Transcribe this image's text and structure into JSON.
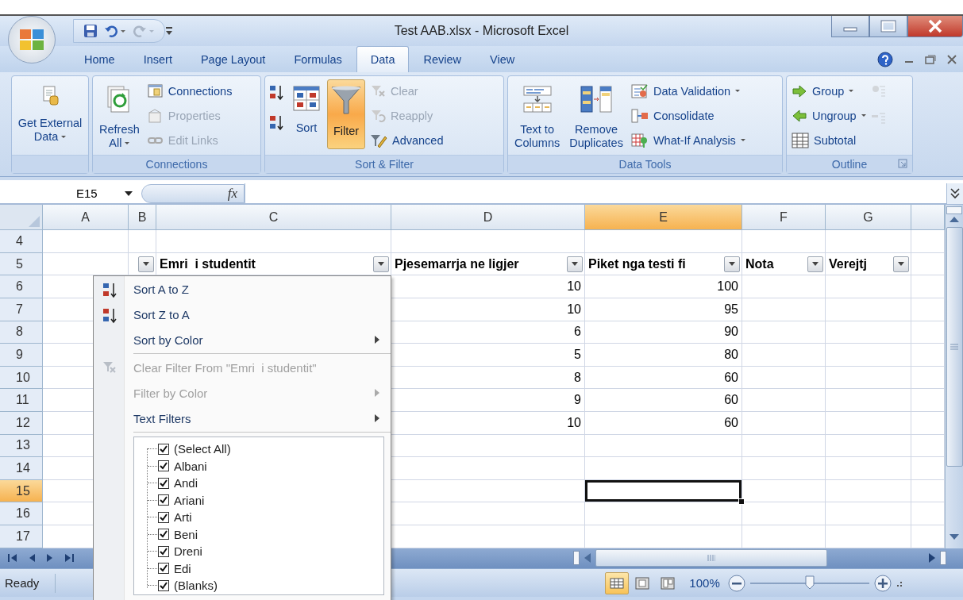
{
  "title_bar": {
    "title": "Test AAB.xlsx - Microsoft Excel"
  },
  "tabs": [
    {
      "label": "Home",
      "selected": false
    },
    {
      "label": "Insert",
      "selected": false
    },
    {
      "label": "Page Layout",
      "selected": false
    },
    {
      "label": "Formulas",
      "selected": false
    },
    {
      "label": "Data",
      "selected": true
    },
    {
      "label": "Review",
      "selected": false
    },
    {
      "label": "View",
      "selected": false
    }
  ],
  "ribbon": {
    "groups": [
      {
        "items": [
          {
            "kind": "large",
            "lines": [
              "Get External",
              "Data"
            ],
            "dropdown": true,
            "pressed": false
          }
        ]
      },
      {
        "label": "Connections",
        "items": [
          {
            "kind": "large",
            "lines": [
              "Refresh",
              "All"
            ],
            "dropdown": true,
            "pressed": false
          },
          {
            "kind": "stack",
            "buttons": [
              {
                "label": "Connections",
                "disabled": false,
                "dropdown": false
              },
              {
                "label": "Properties",
                "disabled": true,
                "dropdown": false
              },
              {
                "label": "Edit Links",
                "disabled": true,
                "dropdown": false
              }
            ]
          }
        ]
      },
      {
        "label": "Sort & Filter",
        "items": [
          {
            "kind": "icons",
            "buttons": [
              {
                "disabled": false
              },
              {
                "disabled": false
              }
            ]
          },
          {
            "kind": "large",
            "lines": [
              "Sort"
            ],
            "dropdown": false,
            "pressed": false
          },
          {
            "kind": "large",
            "lines": [
              "Filter"
            ],
            "dropdown": false,
            "pressed": true
          },
          {
            "kind": "stack",
            "buttons": [
              {
                "label": "Clear",
                "disabled": true,
                "dropdown": false
              },
              {
                "label": "Reapply",
                "disabled": true,
                "dropdown": false
              },
              {
                "label": "Advanced",
                "disabled": false,
                "dropdown": false
              }
            ]
          }
        ]
      },
      {
        "label": "Data Tools",
        "items": [
          {
            "kind": "large",
            "lines": [
              "Text to",
              "Columns"
            ],
            "dropdown": false,
            "pressed": false
          },
          {
            "kind": "large",
            "lines": [
              "Remove",
              "Duplicates"
            ],
            "dropdown": false,
            "pressed": false
          },
          {
            "kind": "stack",
            "buttons": [
              {
                "label": "Data Validation",
                "disabled": false,
                "dropdown": true
              },
              {
                "label": "Consolidate",
                "disabled": false,
                "dropdown": false
              },
              {
                "label": "What-If Analysis",
                "disabled": false,
                "dropdown": true
              }
            ]
          }
        ]
      },
      {
        "label": "Outline",
        "dialog_launcher": true,
        "items": [
          {
            "kind": "stack",
            "buttons": [
              {
                "label": "Group",
                "disabled": false,
                "dropdown": true
              },
              {
                "label": "Ungroup",
                "disabled": false,
                "dropdown": true
              },
              {
                "label": "Subtotal",
                "disabled": false,
                "dropdown": false
              }
            ]
          },
          {
            "kind": "icons",
            "buttons": [
              {
                "disabled": true
              },
              {
                "disabled": true
              }
            ]
          }
        ]
      }
    ]
  },
  "formula_bar": {
    "name_box": "E15",
    "function_button": "fx"
  },
  "grid": {
    "columns": [
      {
        "label": "A",
        "selected": false
      },
      {
        "label": "B",
        "selected": false
      },
      {
        "label": "C",
        "selected": false
      },
      {
        "label": "D",
        "selected": false
      },
      {
        "label": "E",
        "selected": true
      },
      {
        "label": "F",
        "selected": false
      },
      {
        "label": "G",
        "selected": false
      }
    ],
    "rows": [
      {
        "number": "4",
        "selected": false,
        "kind": "data",
        "cells": [
          null,
          null,
          null,
          null,
          null,
          null,
          null
        ]
      },
      {
        "number": "5",
        "selected": false,
        "kind": "header",
        "cells": [
          null,
          {
            "filter_button": true
          },
          {
            "text": "Emri  i studentit",
            "filter_button": true
          },
          {
            "text": "Pjesemarrja ne ligjer",
            "filter_button": true
          },
          {
            "text": "Piket nga testi fi",
            "filter_button": true
          },
          {
            "text": "Nota",
            "filter_button": true
          },
          {
            "text": "Verejtj",
            "filter_button": true
          }
        ]
      },
      {
        "number": "6",
        "selected": false,
        "kind": "data",
        "cells": [
          null,
          null,
          null,
          "10",
          "100",
          null,
          null
        ]
      },
      {
        "number": "7",
        "selected": false,
        "kind": "data",
        "cells": [
          null,
          null,
          null,
          "10",
          "95",
          null,
          null
        ]
      },
      {
        "number": "8",
        "selected": false,
        "kind": "data",
        "cells": [
          null,
          null,
          null,
          "6",
          "90",
          null,
          null
        ]
      },
      {
        "number": "9",
        "selected": false,
        "kind": "data",
        "cells": [
          null,
          null,
          null,
          "5",
          "80",
          null,
          null
        ]
      },
      {
        "number": "10",
        "selected": false,
        "kind": "data",
        "cells": [
          null,
          null,
          null,
          "8",
          "60",
          null,
          null
        ]
      },
      {
        "number": "11",
        "selected": false,
        "kind": "data",
        "cells": [
          null,
          null,
          null,
          "9",
          "60",
          null,
          null
        ]
      },
      {
        "number": "12",
        "selected": false,
        "kind": "data",
        "cells": [
          null,
          null,
          null,
          "10",
          "60",
          null,
          null
        ]
      },
      {
        "number": "13",
        "selected": false,
        "kind": "data",
        "cells": [
          null,
          null,
          null,
          null,
          null,
          null,
          null
        ]
      },
      {
        "number": "14",
        "selected": false,
        "kind": "data",
        "cells": [
          null,
          null,
          null,
          null,
          null,
          null,
          null
        ]
      },
      {
        "number": "15",
        "selected": true,
        "kind": "data",
        "cells": [
          null,
          null,
          null,
          null,
          null,
          null,
          null
        ]
      },
      {
        "number": "16",
        "selected": false,
        "kind": "data",
        "cells": [
          null,
          null,
          null,
          null,
          null,
          null,
          null
        ]
      },
      {
        "number": "17",
        "selected": false,
        "kind": "data",
        "cells": [
          null,
          null,
          null,
          null,
          null,
          null,
          null
        ]
      }
    ]
  },
  "filter_menu": {
    "items": [
      {
        "kind": "ascending",
        "label": "Sort A to Z",
        "disabled": false,
        "submenu": false
      },
      {
        "kind": "descending",
        "label": "Sort Z to A",
        "disabled": false,
        "submenu": false
      },
      {
        "kind": "command",
        "label": "Sort by Color",
        "disabled": false,
        "submenu": true
      },
      {
        "kind": "separator"
      },
      {
        "kind": "clear",
        "label": "Clear Filter From \"Emri  i studentit\"",
        "disabled": true,
        "submenu": false
      },
      {
        "kind": "command",
        "label": "Filter by Color",
        "disabled": true,
        "submenu": true
      },
      {
        "kind": "command",
        "label": "Text Filters",
        "disabled": false,
        "submenu": true
      }
    ],
    "values": [
      {
        "label": "(Select All)",
        "checked": true
      },
      {
        "label": "Albani",
        "checked": true
      },
      {
        "label": "Andi",
        "checked": true
      },
      {
        "label": "Ariani",
        "checked": true
      },
      {
        "label": "Arti",
        "checked": true
      },
      {
        "label": "Beni",
        "checked": true
      },
      {
        "label": "Dreni",
        "checked": true
      },
      {
        "label": "Edi",
        "checked": true
      },
      {
        "label": "(Blanks)",
        "checked": true
      }
    ]
  },
  "status_bar": {
    "text": "Ready",
    "views": [
      {
        "selected": true
      },
      {
        "selected": false
      },
      {
        "selected": false
      }
    ],
    "zoom": "100%",
    "zoom_slider": {
      "level": 0.5
    }
  }
}
